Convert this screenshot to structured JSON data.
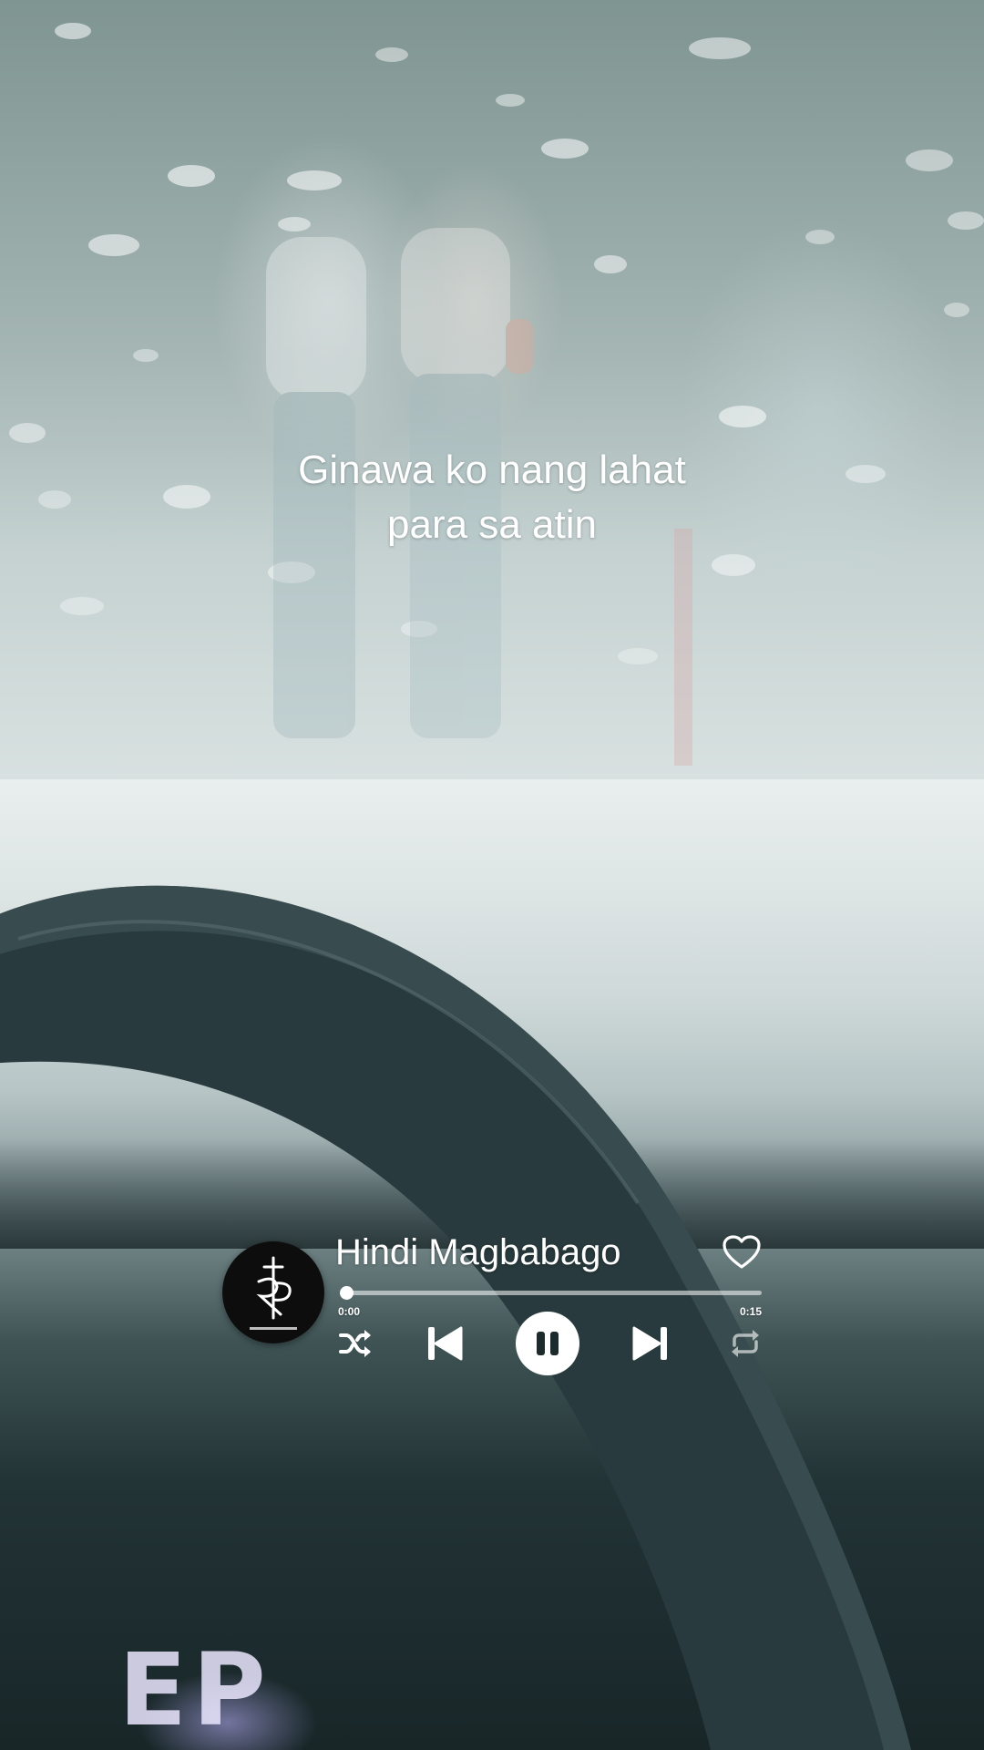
{
  "lyrics": {
    "line1": "Ginawa ko nang lahat",
    "line2": "para sa atin"
  },
  "player": {
    "track_title": "Hindi Magbabago",
    "album_art_icon": "rp-monogram-logo",
    "elapsed_time": "0:00",
    "total_time": "0:15",
    "progress_fraction": 0.0,
    "is_playing": true,
    "controls": {
      "like_icon": "heart-outline-icon",
      "shuffle_icon": "shuffle-icon",
      "previous_icon": "skip-previous-icon",
      "pause_icon": "pause-icon",
      "next_icon": "skip-next-icon",
      "repeat_icon": "repeat-icon"
    }
  },
  "colors": {
    "text": "#ffffff",
    "album_art_bg": "#0d0d0d"
  }
}
